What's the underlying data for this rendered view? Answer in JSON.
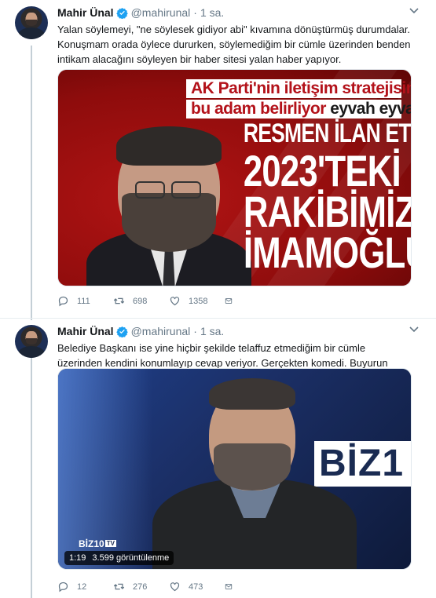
{
  "tweets": [
    {
      "name": "Mahir Ünal",
      "handle": "@mahirunal",
      "separator": "·",
      "time": "1 sa.",
      "text": "Yalan söylemeyi, \"ne söylesek gidiyor abi\" kıvamına dönüştürmüş  durumdalar. Konuşmam orada öylece dururken, söylemediğim bir cümle üzerinden benden intikam alacağını söyleyen bir haber sitesi yalan haber yapıyor.",
      "media": {
        "banner_line1": "AK Parti'nin iletişim stratejisini",
        "banner_line2": "bu adam belirliyor",
        "banner_line2_suffix": "eyvah eyvah",
        "headline1": "RESMEN İLAN ETTİ",
        "headline2": "2023'TEKİ",
        "headline3": "RAKİBİMİZ",
        "headline4": "İMAMOĞLU"
      },
      "replies": "111",
      "retweets": "698",
      "likes": "1358"
    },
    {
      "name": "Mahir Ünal",
      "handle": "@mahirunal",
      "separator": "·",
      "time": "1 sa.",
      "text": "Belediye Başkanı ise yine hiçbir şekilde telaffuz etmediğim bir cümle üzerinden kendini konumlayıp cevap veriyor. Gerçekten komedi. Buyurun gerçek burada.",
      "media": {
        "logo_big": "BİZ1",
        "logo_small": "BİZ10",
        "logo_small_tv": "TV",
        "duration": "1:19",
        "views": "3.599 görüntülenme"
      },
      "replies": "12",
      "retweets": "276",
      "likes": "473"
    }
  ],
  "colors": {
    "verified": "#1da1f2",
    "muted": "#657786",
    "thread_line": "#c4cfd6"
  },
  "icons": [
    "verified-badge-icon",
    "chevron-down-icon",
    "reply-icon",
    "retweet-icon",
    "like-icon",
    "direct-message-icon"
  ]
}
